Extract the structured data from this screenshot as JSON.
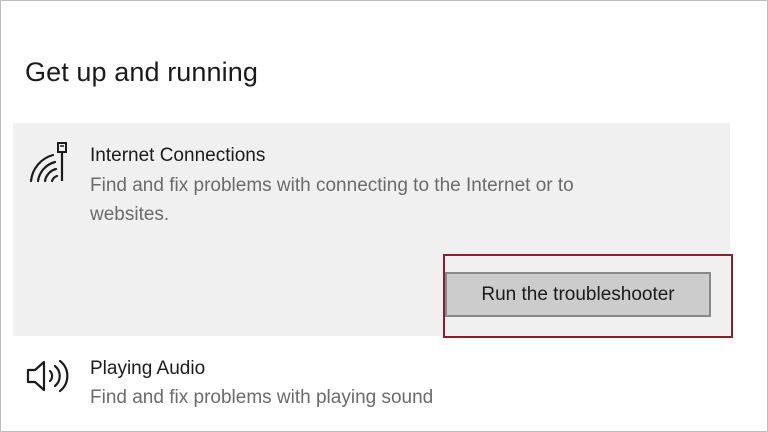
{
  "page": {
    "title": "Get up and running"
  },
  "items": [
    {
      "icon": "network-icon",
      "title": "Internet Connections",
      "description_line1": "Find and fix problems with connecting to the Internet or to",
      "description_line2": "websites.",
      "expanded": true,
      "button_label": "Run the troubleshooter"
    },
    {
      "icon": "speaker-icon",
      "title": "Playing Audio",
      "description_line1": "Find and fix problems with playing sound"
    }
  ],
  "colors": {
    "panel_background": "#f0f0f0",
    "button_background": "#cccccc",
    "highlight_border": "#8b1e2e",
    "secondary_text": "#6b6b6b"
  }
}
